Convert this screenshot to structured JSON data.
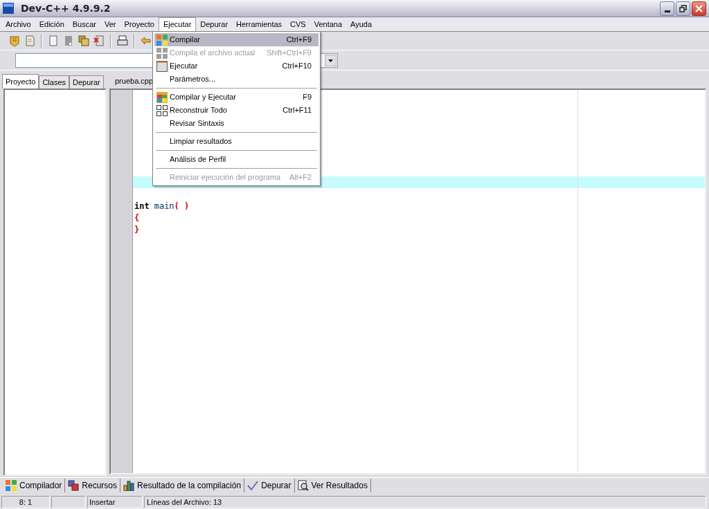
{
  "window": {
    "title": "Dev-C++ 4.9.9.2"
  },
  "menu_bar": [
    {
      "label": "Archivo",
      "selected": false
    },
    {
      "label": "Edición",
      "selected": false
    },
    {
      "label": "Buscar",
      "selected": false
    },
    {
      "label": "Ver",
      "selected": false
    },
    {
      "label": "Proyecto",
      "selected": false
    },
    {
      "label": "Ejecutar",
      "selected": true
    },
    {
      "label": "Depurar",
      "selected": false
    },
    {
      "label": "Herramientas",
      "selected": false
    },
    {
      "label": "CVS",
      "selected": false
    },
    {
      "label": "Ventana",
      "selected": false
    },
    {
      "label": "Ayuda",
      "selected": false
    }
  ],
  "open_menu": {
    "items": [
      {
        "kind": "item",
        "label": "Compilar",
        "shortcut": "Ctrl+F9",
        "disabled": false,
        "selected": true
      },
      {
        "kind": "item",
        "label": "Compila el archivo actual",
        "shortcut": "Shift+Ctrl+F9",
        "disabled": true,
        "selected": false
      },
      {
        "kind": "item",
        "label": "Ejecutar",
        "shortcut": "Ctrl+F10",
        "disabled": false,
        "selected": false
      },
      {
        "kind": "item",
        "label": "Parámetros...",
        "disabled": false,
        "selected": false
      },
      {
        "kind": "separator"
      },
      {
        "kind": "item",
        "label": "Compilar y Ejecutar",
        "shortcut": "F9",
        "disabled": false,
        "selected": false
      },
      {
        "kind": "item",
        "label": "Reconstruir Todo",
        "shortcut": "Ctrl+F11",
        "disabled": false,
        "selected": false
      },
      {
        "kind": "item",
        "label": "Revisar Sintaxis",
        "disabled": false,
        "selected": false
      },
      {
        "kind": "separator"
      },
      {
        "kind": "item",
        "label": "Limpiar resultados",
        "disabled": false,
        "selected": false
      },
      {
        "kind": "separator"
      },
      {
        "kind": "item",
        "label": "Análisis de Perfil",
        "disabled": false,
        "selected": false
      },
      {
        "kind": "separator"
      },
      {
        "kind": "item",
        "label": "Reiniciar ejecución del programa",
        "shortcut": "Alt+F2",
        "disabled": true,
        "selected": false
      }
    ]
  },
  "side_tabs": [
    {
      "label": "Proyecto",
      "selected": true
    },
    {
      "label": "Clases",
      "selected": false
    },
    {
      "label": "Depurar",
      "selected": false
    }
  ],
  "editor": {
    "tab": "prueba.cpp",
    "lines": [
      {
        "kind": "blank"
      },
      {
        "kind": "blank"
      },
      {
        "kind": "blank"
      },
      {
        "kind": "blank"
      },
      {
        "kind": "blank"
      },
      {
        "kind": "blank"
      },
      {
        "kind": "blank"
      },
      {
        "kind": "current"
      },
      {
        "kind": "blank"
      },
      {
        "kind": "code",
        "tokens": [
          {
            "text": "int",
            "kind": "keyword"
          },
          {
            "text": "main",
            "kind": "ident"
          },
          {
            "text": "( )",
            "kind": "symbol"
          }
        ]
      },
      {
        "kind": "code",
        "tokens": [
          {
            "text": "{",
            "kind": "symbol"
          }
        ]
      },
      {
        "kind": "code",
        "tokens": [
          {
            "text": "}",
            "kind": "symbol"
          }
        ]
      },
      {
        "kind": "blank"
      }
    ]
  },
  "bottom_tabs": [
    "Compilador",
    "Recursos",
    "Resultado de la compilación",
    "Depurar",
    "Ver Resultados"
  ],
  "status_bar": [
    "8: 1",
    "Insertar",
    "Líneas del Archivo: 13"
  ]
}
